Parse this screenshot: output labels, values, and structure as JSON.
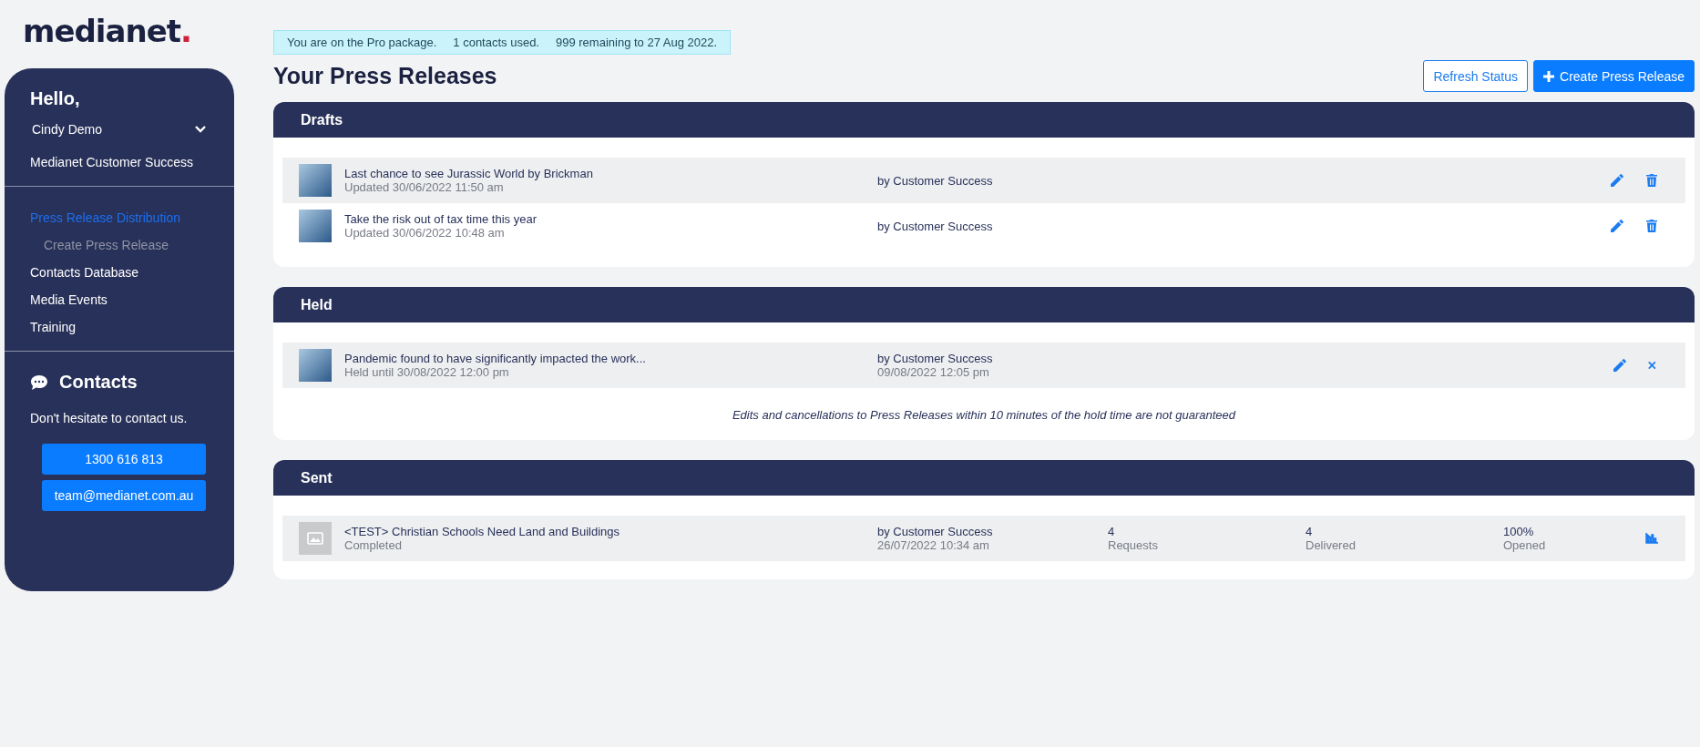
{
  "logo": {
    "text": "medianet",
    "mark": "."
  },
  "sidebar": {
    "greeting": "Hello,",
    "user": "Cindy Demo",
    "organisation": "Medianet Customer Success",
    "nav": [
      {
        "label": "Press Release Distribution",
        "selected": true,
        "children": [
          {
            "label": "Create Press Release",
            "selected": false
          }
        ]
      },
      {
        "label": "Contacts Database",
        "selected": false
      },
      {
        "label": "Media Events",
        "selected": false
      },
      {
        "label": "Training",
        "selected": false
      }
    ],
    "contacts": {
      "title": "Contacts",
      "text": "Don't hesitate to contact us.",
      "buttons": [
        "1300 616 813",
        "team@medianet.com.au"
      ]
    }
  },
  "banner": [
    "You are on the Pro package.",
    "1 contacts used.",
    "999 remaining to 27 Aug 2022."
  ],
  "title": "Your Press Releases",
  "buttons": [
    {
      "label": "Refresh Status",
      "kind": "outline"
    },
    {
      "label": "Create Press Release",
      "kind": "primary"
    }
  ],
  "sections": [
    {
      "title": "Drafts",
      "rows": [
        {
          "thumbnail": {
            "kind": "photo"
          },
          "highlighted": true,
          "title": "Last chance to see Jurassic World by Brickman",
          "status": "Updated 30/06/2022 11:50 am",
          "by": "by Customer Success",
          "actions": [
            {
              "kind": "edit"
            },
            {
              "kind": "delete"
            }
          ]
        },
        {
          "thumbnail": {
            "kind": "photo"
          },
          "highlighted": false,
          "title": "Take the risk out of tax time this year",
          "status": "Updated 30/06/2022 10:48 am",
          "by": "by Customer Success",
          "actions": [
            {
              "kind": "edit"
            },
            {
              "kind": "delete"
            }
          ]
        }
      ]
    },
    {
      "title": "Held",
      "rows": [
        {
          "thumbnail": {
            "kind": "photo"
          },
          "highlighted": true,
          "title": "Pandemic found to have significantly impacted the work...",
          "status": "Held until 30/08/2022 12:00 pm",
          "by": "by Customer Success",
          "date": "09/08/2022 12:05 pm",
          "actions": [
            {
              "kind": "edit"
            },
            {
              "kind": "cancel"
            }
          ]
        }
      ],
      "note": "Edits and cancellations to Press Releases within 10 minutes of the hold time are not guaranteed"
    },
    {
      "title": "Sent",
      "rows": [
        {
          "thumbnail": {
            "kind": "empty"
          },
          "highlighted": true,
          "title": "<TEST> Christian Schools Need Land and Buildings",
          "status": "Completed",
          "by": "by Customer Success",
          "date": "26/07/2022 10:34 am",
          "stats": [
            {
              "value": "4",
              "label": "Requests"
            },
            {
              "value": "4",
              "label": "Delivered"
            },
            {
              "value": "100%",
              "label": "Opened"
            }
          ],
          "actions": [
            {
              "kind": "report"
            }
          ]
        }
      ]
    }
  ]
}
